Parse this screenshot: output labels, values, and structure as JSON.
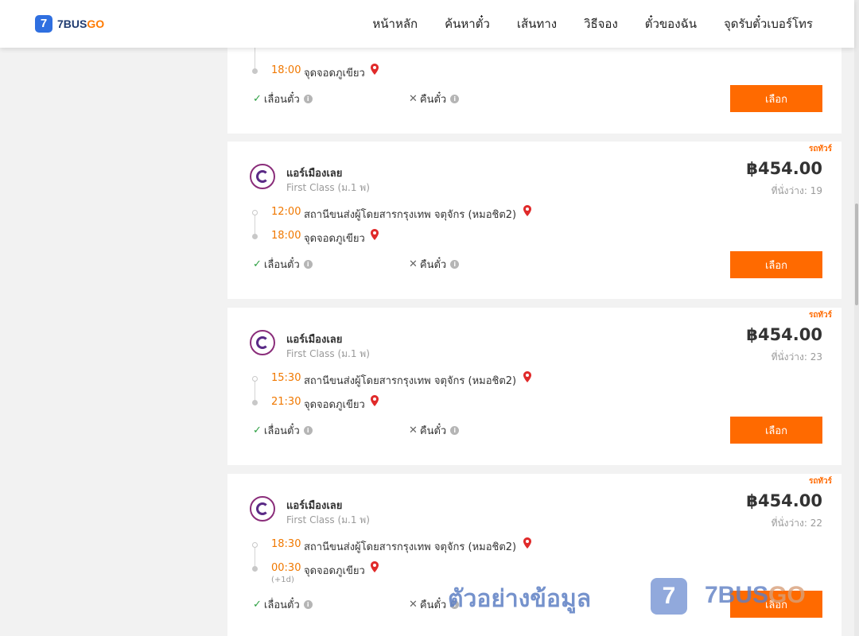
{
  "header": {
    "logo_mark": "7",
    "logo_text_main": "7BUS",
    "logo_text_accent": "GO",
    "nav": [
      "หน้าหลัก",
      "ค้นหาตั๋ว",
      "เส้นทาง",
      "วิธีจอง",
      "ตั๋วของฉัน",
      "จุดรับตั๋วเบอร์โทร"
    ]
  },
  "partial_card": {
    "arr_time": "18:00",
    "arr_station": "จุดจอดภูเขียว",
    "change": "เลื่อนตั๋ว",
    "refund": "คืนตั๋ว",
    "select": "เลือก"
  },
  "cards": [
    {
      "badge": "รถทัวร์",
      "operator": "แอร์เมืองเลย",
      "class": "First Class (ม.1 พ)",
      "price": "฿454.00",
      "seats": "ที่นั่งว่าง: 19",
      "dep_time": "12:00",
      "dep_station": "สถานีขนส่งผู้โดยสารกรุงเทพ จตุจักร (หมอชิต2)",
      "arr_time": "18:00",
      "arr_station": "จุดจอดภูเขียว",
      "change": "เลื่อนตั๋ว",
      "refund": "คืนตั๋ว",
      "select": "เลือก"
    },
    {
      "badge": "รถทัวร์",
      "operator": "แอร์เมืองเลย",
      "class": "First Class (ม.1 พ)",
      "price": "฿454.00",
      "seats": "ที่นั่งว่าง: 23",
      "dep_time": "15:30",
      "dep_station": "สถานีขนส่งผู้โดยสารกรุงเทพ จตุจักร (หมอชิต2)",
      "arr_time": "21:30",
      "arr_station": "จุดจอดภูเขียว",
      "change": "เลื่อนตั๋ว",
      "refund": "คืนตั๋ว",
      "select": "เลือก"
    },
    {
      "badge": "รถทัวร์",
      "operator": "แอร์เมืองเลย",
      "class": "First Class (ม.1 พ)",
      "price": "฿454.00",
      "seats": "ที่นั่งว่าง: 22",
      "dep_time": "18:30",
      "dep_station": "สถานีขนส่งผู้โดยสารกรุงเทพ จตุจักร (หมอชิต2)",
      "arr_time": "00:30",
      "arr_station": "จุดจอดภูเขียว",
      "plus_day": "(+1d)",
      "change": "เลื่อนตั๋ว",
      "refund": "คืนตั๋ว",
      "select": "เลือก"
    }
  ],
  "watermark": {
    "text": "ตัวอย่างข้อมูล",
    "mark": "7",
    "brand_main": "7BUS",
    "brand_accent": "GO"
  },
  "colors": {
    "accent": "#ff6a00",
    "time": "#f07800",
    "check": "#2ea043",
    "pin": "#e02a2a"
  }
}
